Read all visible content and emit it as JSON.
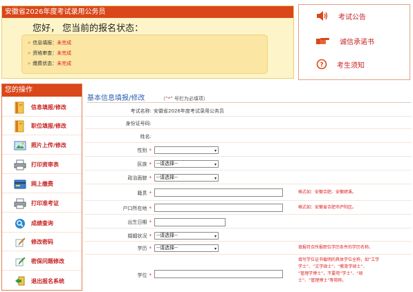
{
  "status": {
    "title": "安徽省2026年度考试录用公务员",
    "greeting": "您好， 您当前的报名状态：",
    "items": [
      {
        "label": "信息填报：",
        "value": "未完成"
      },
      {
        "label": "资格审查：",
        "value": "未完成"
      },
      {
        "label": "缴费状态：",
        "value": "未完成"
      }
    ]
  },
  "links": [
    {
      "label": "考试公告",
      "icon": "speaker-icon"
    },
    {
      "label": "诚信承诺书",
      "icon": "pointing-hand-icon"
    },
    {
      "label": "考生须知",
      "icon": "question-icon"
    }
  ],
  "sidebar": {
    "title": "您的操作",
    "items": [
      {
        "label": "信息填报/修改",
        "icon": "book-icon"
      },
      {
        "label": "职位填报/修改",
        "icon": "book-icon"
      },
      {
        "label": "照片上传/修改",
        "icon": "photo-upload-icon"
      },
      {
        "label": "打印资审表",
        "icon": "printer-icon"
      },
      {
        "label": "网上缴费",
        "icon": "card-icon"
      },
      {
        "label": "打印准考证",
        "icon": "printer-icon"
      },
      {
        "label": "成绩查询",
        "icon": "search-icon"
      },
      {
        "label": "修改密码",
        "icon": "pencil-icon"
      },
      {
        "label": "密保问题修改",
        "icon": "pencil-icon"
      },
      {
        "label": "退出报名系统",
        "icon": "exit-icon"
      }
    ]
  },
  "form": {
    "title": "基本信息填报/修改",
    "note_open": "（“",
    "note_star": "*",
    "note_close": "” 号栏为必填项）",
    "exam_name_label": "考试名称:",
    "exam_name_value": "安徽省2026年度考试录用公务员",
    "id_label": "身份证号码:",
    "name_label": "姓名:",
    "gender_label": "性别",
    "nation_label": "民族",
    "nation_value": "--请选择--",
    "politics_label": "政治面貌",
    "politics_value": "--请选择--",
    "origin_label": "籍贯",
    "origin_hint": "格式如：安徽合肥、安徽绩溪。",
    "hukou_label": "户口所在地",
    "hukou_hint": "格式如：安徽省合肥市庐阳区。",
    "birth_label": "出生日期",
    "marital_label": "婚姻状况",
    "marital_value": "--请选择--",
    "education_label": "学历",
    "education_value": "--请选择--",
    "education_hint": "填报符合所报职位学历条件的学历名称。",
    "degree_label": "学位",
    "degree_hint_1": "填写学位证书载明的具体学位全称，如“工学",
    "degree_hint_2": "学士”、“文学硕士”、“教育学硕士”、",
    "degree_hint_3": "“管理学博士”，不要用“学士”、“硕",
    "degree_hint_4": "士”、“管理博士”等简称。",
    "required_mark": "*"
  },
  "colors": {
    "header_red": "#d9471a",
    "link_red": "#c82323",
    "title_blue": "#2f5fb0",
    "panel_yellow": "#fdf5c9"
  }
}
